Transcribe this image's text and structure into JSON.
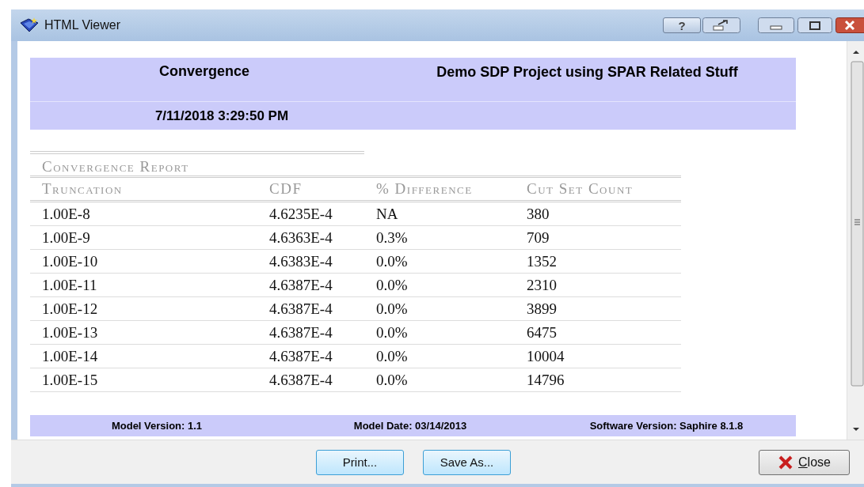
{
  "window": {
    "title": "HTML Viewer",
    "help_button": "?"
  },
  "header": {
    "title": "Convergence",
    "project": "Demo SDP Project using SPAR Related Stuff",
    "timestamp": "7/11/2018 3:29:50 PM"
  },
  "report": {
    "title": "Convergence Report",
    "columns": [
      "Truncation",
      "CDF",
      "% Difference",
      "Cut Set Count"
    ],
    "rows": [
      [
        "1.00E-8",
        "4.6235E-4",
        "NA",
        "380"
      ],
      [
        "1.00E-9",
        "4.6363E-4",
        "0.3%",
        "709"
      ],
      [
        "1.00E-10",
        "4.6383E-4",
        "0.0%",
        "1352"
      ],
      [
        "1.00E-11",
        "4.6387E-4",
        "0.0%",
        "2310"
      ],
      [
        "1.00E-12",
        "4.6387E-4",
        "0.0%",
        "3899"
      ],
      [
        "1.00E-13",
        "4.6387E-4",
        "0.0%",
        "6475"
      ],
      [
        "1.00E-14",
        "4.6387E-4",
        "0.0%",
        "10004"
      ],
      [
        "1.00E-15",
        "4.6387E-4",
        "0.0%",
        "14796"
      ]
    ]
  },
  "footer": [
    "Model Version: 1.1",
    "Model Date: 03/14/2013",
    "Software Version: Saphire 8.1.8"
  ],
  "buttons": [
    {
      "label": "Print...",
      "kind": "plain"
    },
    {
      "label": "Save As...",
      "kind": "plain"
    },
    {
      "label": "Close",
      "kind": "close"
    }
  ]
}
